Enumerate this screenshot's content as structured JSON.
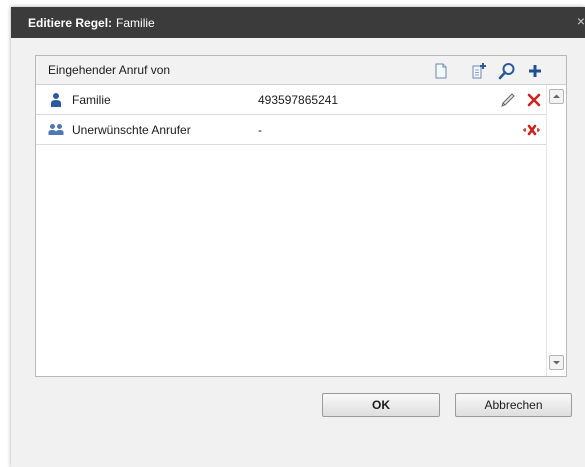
{
  "dialog": {
    "title_prefix": "Editiere Regel:",
    "title_name": "Familie",
    "close_symbol": "×"
  },
  "list": {
    "header_label": "Eingehender Anruf von",
    "header_icons": [
      "new-document-icon",
      "add-list-icon",
      "search-icon",
      "plus-icon"
    ],
    "rows": [
      {
        "icon": "person-icon",
        "name": "Familie",
        "number": "493597865241",
        "actions": [
          "edit-pencil-icon",
          "delete-x-icon"
        ]
      },
      {
        "icon": "group-icon",
        "name": "Unerwünschte Anrufer",
        "number": "-",
        "actions": [
          "delete-group-icon"
        ]
      }
    ]
  },
  "buttons": {
    "ok_label": "OK",
    "cancel_label": "Abbrechen"
  },
  "colors": {
    "titlebar": "#3b3b3b",
    "dialog_bg": "#f1f1f1",
    "accent_blue": "#2d5a9a",
    "delete_red": "#d2201b"
  }
}
